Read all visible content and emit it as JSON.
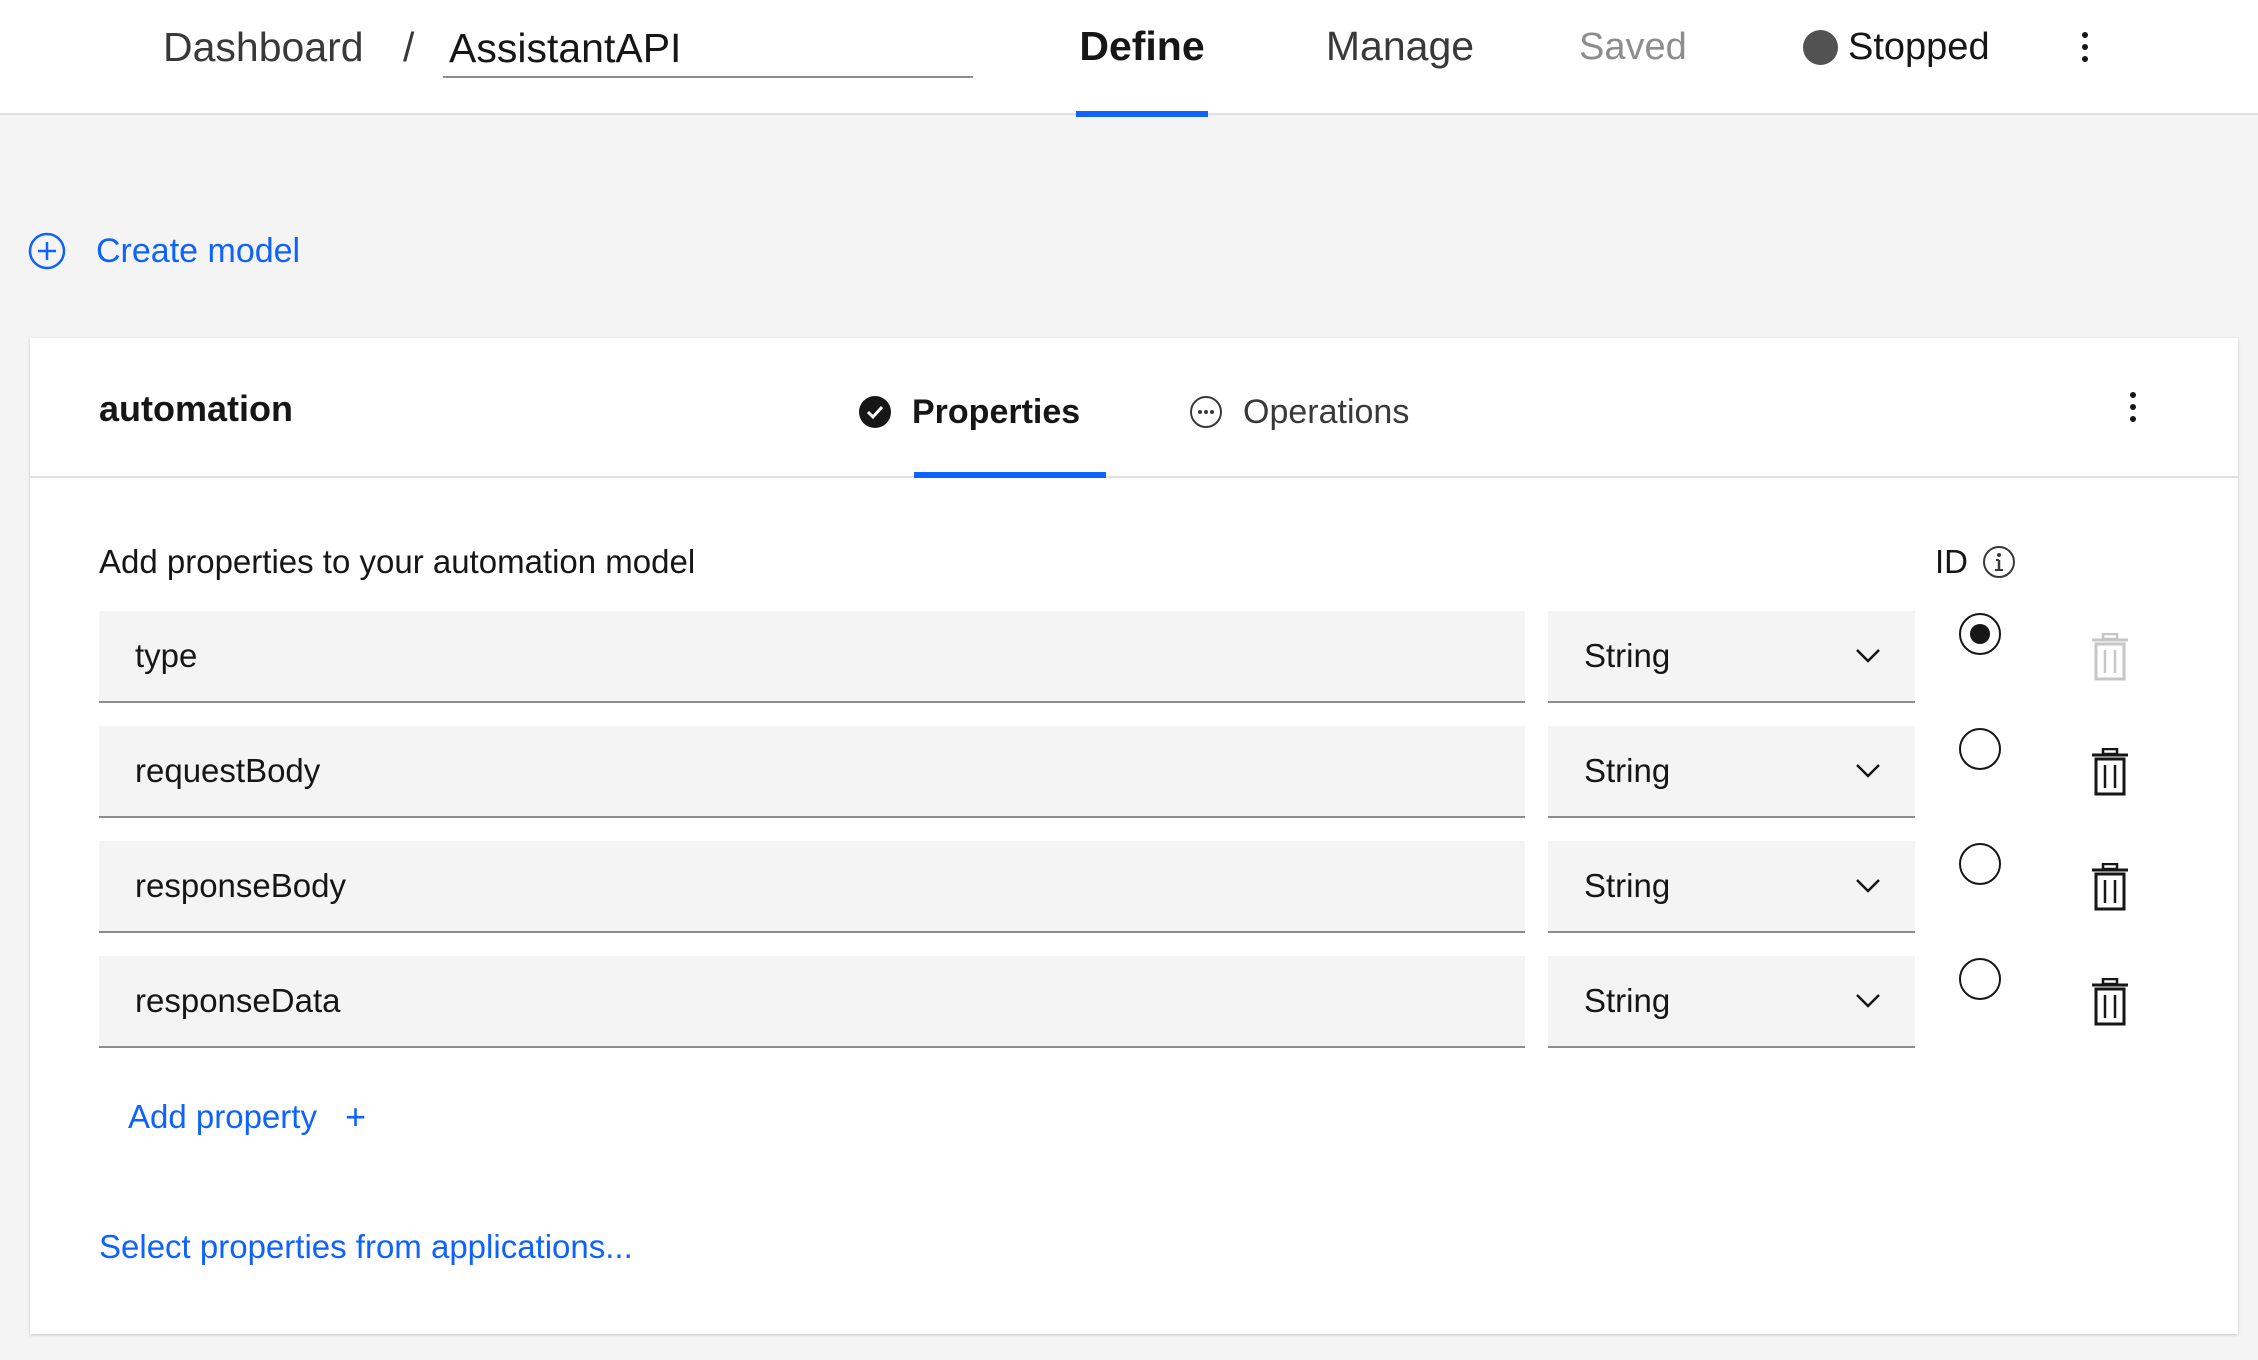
{
  "header": {
    "breadcrumb": "Dashboard",
    "separator": "/",
    "app_name": "AssistantAPI",
    "tabs": [
      {
        "label": "Define",
        "active": true
      },
      {
        "label": "Manage",
        "active": false
      }
    ],
    "save_status": "Saved",
    "run_status": "Stopped"
  },
  "create_model_label": "Create model",
  "model": {
    "name": "automation",
    "tabs": [
      {
        "label": "Properties",
        "active": true,
        "icon": "checkmark-filled-icon"
      },
      {
        "label": "Operations",
        "active": false,
        "icon": "overflow-circle-icon"
      }
    ],
    "section_label": "Add properties to your automation model",
    "id_label": "ID",
    "properties": [
      {
        "name": "type",
        "type": "String",
        "is_id": true,
        "deletable": false
      },
      {
        "name": "requestBody",
        "type": "String",
        "is_id": false,
        "deletable": true
      },
      {
        "name": "responseBody",
        "type": "String",
        "is_id": false,
        "deletable": true
      },
      {
        "name": "responseData",
        "type": "String",
        "is_id": false,
        "deletable": true
      }
    ],
    "add_property_label": "Add property",
    "add_property_icon": "+",
    "select_from_apps_label": "Select properties from applications..."
  },
  "colors": {
    "accent": "#0f62fe",
    "status_stopped": "#525252",
    "field_bg": "#f4f4f4"
  }
}
